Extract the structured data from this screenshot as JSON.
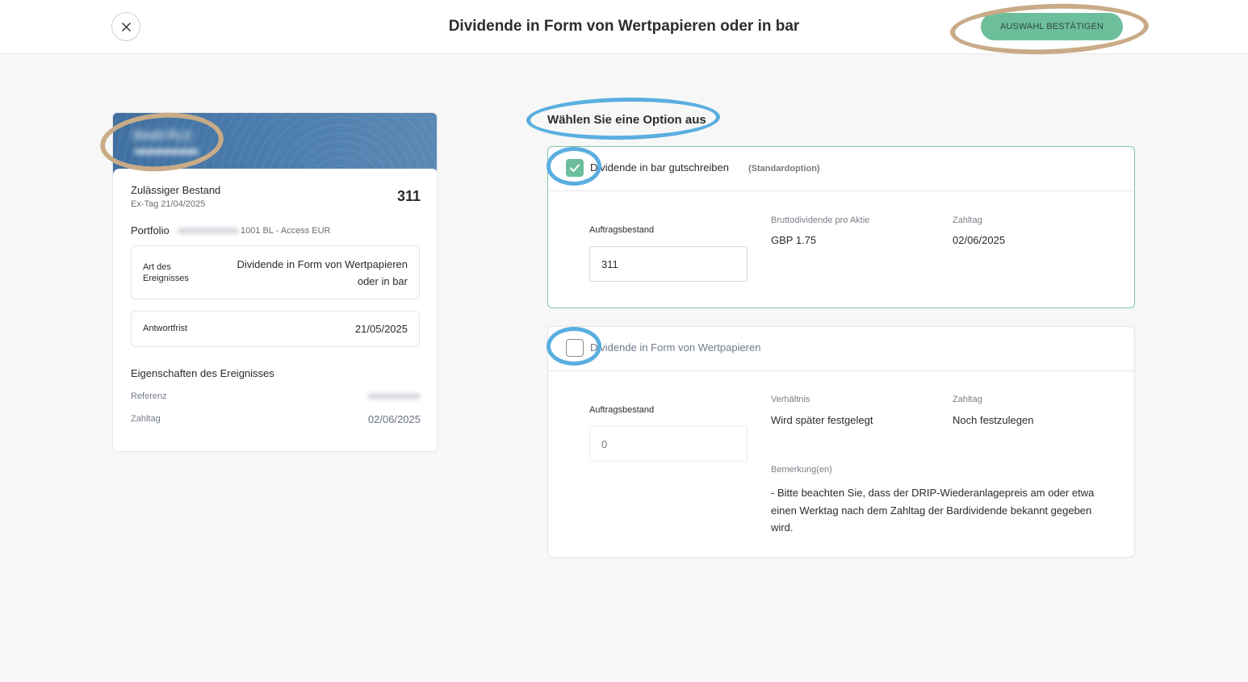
{
  "header": {
    "title": "Dividende in Form von Wertpapieren oder in bar",
    "confirm_label": "AUSWAHL BESTÄTIGEN"
  },
  "card": {
    "company_name": "Shell PLC",
    "holding_label": "Zulässiger Bestand",
    "holding_value": "311",
    "ex_date": "Ex-Tag 21/04/2025",
    "portfolio_label": "Portfolio",
    "portfolio_account": "1001 BL - Access EUR",
    "event_type_label": "Art des Ereignisses",
    "event_type_value": "Dividende in Form von Wertpapieren oder in bar",
    "deadline_label": "Antwortfrist",
    "deadline_value": "21/05/2025",
    "properties_heading": "Eigenschaften des Ereignisses",
    "reference_label": "Referenz",
    "paydate_label": "Zahltag",
    "paydate_value": "02/06/2025"
  },
  "options_heading": "Wählen Sie eine Option aus",
  "options": [
    {
      "title": "Dividende in bar gutschreiben",
      "tag": "(Standardoption)",
      "checked": true,
      "quantity_label": "Auftragsbestand",
      "quantity_value": "311",
      "col1_label": "Bruttodividende pro Aktie",
      "col1_value": "GBP 1.75",
      "col2_label": "Zahltag",
      "col2_value": "02/06/2025"
    },
    {
      "title": "Dividende in Form von Wertpapieren",
      "checked": false,
      "quantity_label": "Auftragsbestand",
      "quantity_placeholder": "0",
      "col1_label": "Verhältnis",
      "col1_value": "Wird später festgelegt",
      "col2_label": "Zahltag",
      "col2_value": "Noch festzulegen",
      "remark_label": "Bemerkung(en)",
      "remark_text": "- Bitte beachten Sie, dass der DRIP-Wiederanlagepreis am oder etwa einen Werktag nach dem Zahltag der Bardividende bekannt gegeben wird."
    }
  ],
  "colors": {
    "accent_green": "#6dbf9c",
    "annotation_gold": "#c9ab87",
    "annotation_blue": "#5aaee0",
    "banner_blue": "#4b7cab"
  },
  "icons": {
    "close": "close-icon",
    "check": "checkmark-icon"
  }
}
